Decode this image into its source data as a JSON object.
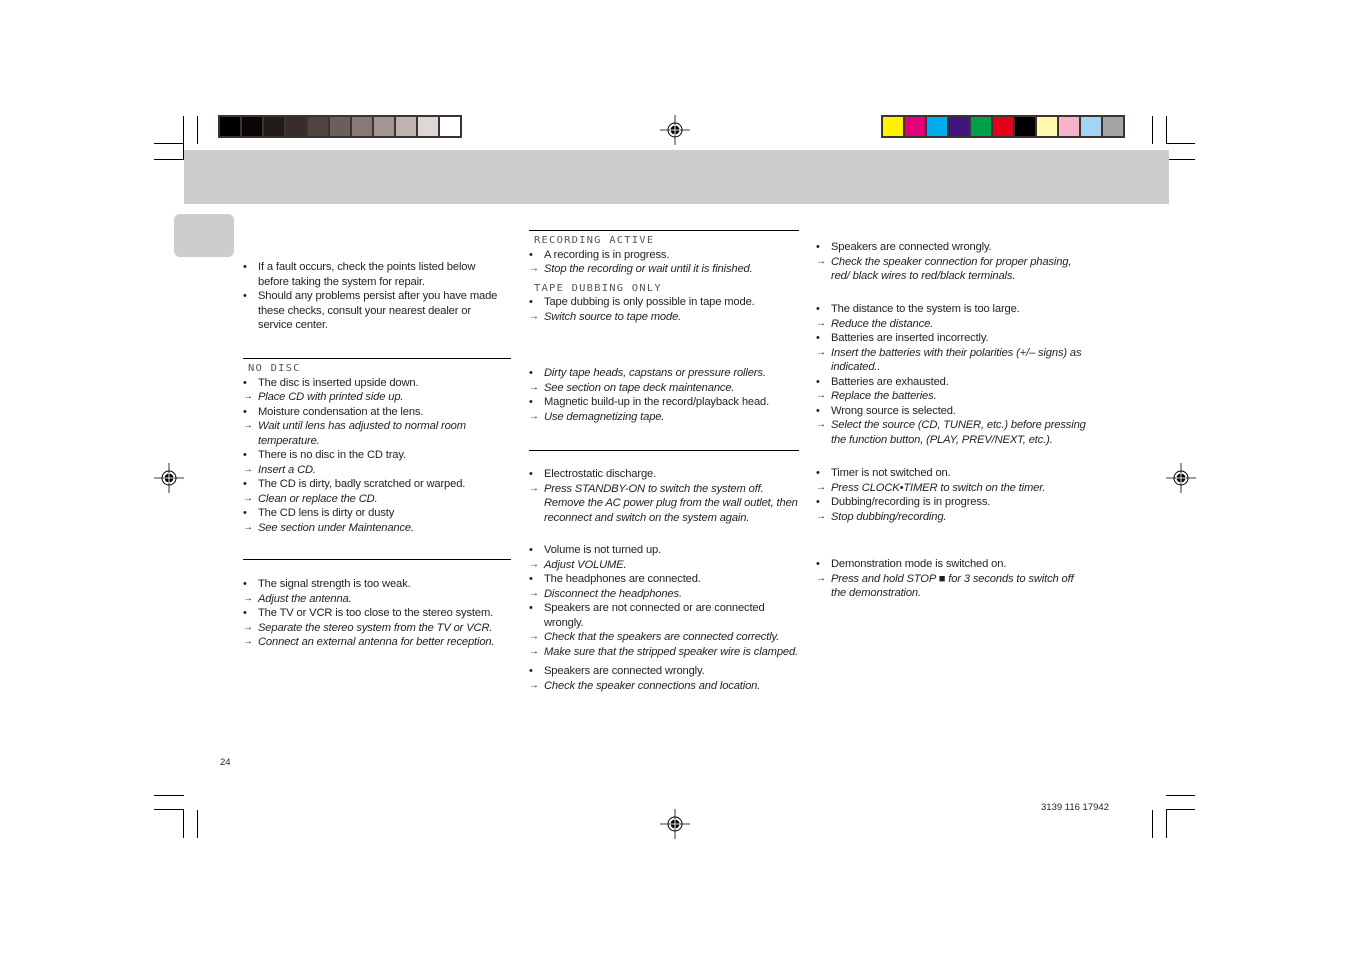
{
  "print_marks": {
    "grayscale_swatches": [
      "#000000",
      "#080606",
      "#221c19",
      "#362c2a",
      "#4e4541",
      "#6a605b",
      "#857a75",
      "#a19692",
      "#bdb4b0",
      "#ddd8d5",
      "#ffffff"
    ],
    "color_swatches": [
      "#fff200",
      "#e4007c",
      "#00aeef",
      "#3f1680",
      "#00a04a",
      "#e2001a",
      "#000000",
      "#fff9b0",
      "#f7b3cc",
      "#a3d4f3",
      "#a3a3a3"
    ]
  },
  "header": {
    "band_color": "#cdcdcd"
  },
  "intro": {
    "items": [
      {
        "type": "cause",
        "text": "If a fault occurs, check the points listed below before taking the system for repair."
      },
      {
        "type": "cause",
        "text": "Should any problems persist after you have made these checks, consult your nearest dealer or service center."
      }
    ]
  },
  "sections": {
    "cd": {
      "display": "NO DISC",
      "items": [
        {
          "type": "cause",
          "text": "The disc is inserted upside down."
        },
        {
          "type": "fix",
          "text": "Place CD with printed side up."
        },
        {
          "type": "cause",
          "text": "Moisture condensation at the lens."
        },
        {
          "type": "fix",
          "text": "Wait until lens has adjusted to normal room temperature."
        },
        {
          "type": "cause",
          "text": "There is no disc in the CD tray."
        },
        {
          "type": "fix",
          "text": "Insert a CD."
        },
        {
          "type": "cause",
          "text": "The CD is dirty, badly scratched or warped."
        },
        {
          "type": "fix",
          "text": "Clean or replace the CD."
        },
        {
          "type": "cause",
          "text": "The CD lens is dirty or dusty"
        },
        {
          "type": "fix",
          "text": "See section under Maintenance."
        }
      ]
    },
    "radio": {
      "items": [
        {
          "type": "cause",
          "text": "The signal strength is too weak."
        },
        {
          "type": "fix",
          "text": "Adjust the antenna."
        },
        {
          "type": "cause",
          "text": "The TV or VCR is too close to the stereo system."
        },
        {
          "type": "fix",
          "text": "Separate the stereo system from the TV or VCR."
        },
        {
          "type": "fix",
          "text": "Connect an external antenna for better reception."
        }
      ]
    },
    "recording": {
      "display": "RECORDING ACTIVE",
      "items": [
        {
          "type": "cause",
          "text": "A recording is in progress."
        },
        {
          "type": "fix",
          "text": "Stop the recording or wait until it is finished."
        }
      ]
    },
    "dubbing": {
      "display": "TAPE DUBBING ONLY",
      "items": [
        {
          "type": "cause",
          "text": "Tape dubbing is only possible in tape mode."
        },
        {
          "type": "fix",
          "text": "Switch source to tape mode."
        }
      ]
    },
    "tape": {
      "items": [
        {
          "type": "cause-italic",
          "text": "Dirty tape heads, capstans or pressure rollers."
        },
        {
          "type": "fix",
          "text": "See section on tape deck maintenance."
        },
        {
          "type": "cause",
          "text": "Magnetic build-up in the record/playback head."
        },
        {
          "type": "fix",
          "text": "Use demagnetizing tape."
        }
      ]
    },
    "no_reaction": {
      "items": [
        {
          "type": "cause",
          "text": "Electrostatic discharge."
        },
        {
          "type": "fix",
          "text": "Press STANDBY-ON to switch the system off. Remove the AC power plug from the wall outlet, then reconnect and switch on the system again."
        }
      ]
    },
    "no_sound": {
      "items": [
        {
          "type": "cause",
          "text": "Volume is not turned up."
        },
        {
          "type": "fix",
          "text": "Adjust VOLUME."
        },
        {
          "type": "cause",
          "text": "The headphones are connected."
        },
        {
          "type": "fix",
          "text": "Disconnect the headphones."
        },
        {
          "type": "cause",
          "text": "Speakers are not connected or are connected wrongly."
        },
        {
          "type": "fix",
          "text": "Check that the speakers are connected correctly."
        },
        {
          "type": "fix",
          "text": "Make sure that the stripped speaker wire is clamped."
        }
      ]
    },
    "sound_bad": {
      "items": [
        {
          "type": "cause",
          "text": "Speakers are connected wrongly."
        },
        {
          "type": "fix",
          "text": "Check the speaker connections and location."
        }
      ]
    },
    "bass": {
      "items": [
        {
          "type": "cause",
          "text": "Speakers are connected wrongly."
        },
        {
          "type": "fix",
          "text": "Check the speaker connection for proper phasing, red/ black wires to red/black terminals."
        }
      ]
    },
    "remote": {
      "items": [
        {
          "type": "cause",
          "text": "The distance to the system is too large."
        },
        {
          "type": "fix",
          "text": "Reduce the distance."
        },
        {
          "type": "cause",
          "text": "Batteries are inserted incorrectly."
        },
        {
          "type": "fix",
          "text": "Insert the batteries with their polarities (+/– signs) as indicated.."
        },
        {
          "type": "cause",
          "text": "Batteries are exhausted."
        },
        {
          "type": "fix",
          "text": "Replace the batteries."
        },
        {
          "type": "cause",
          "text": "Wrong source is selected."
        },
        {
          "type": "fix",
          "text": "Select the source (CD, TUNER, etc.) before pressing the function button, (PLAY, PREV/NEXT, etc.)."
        }
      ]
    },
    "timer": {
      "items": [
        {
          "type": "cause",
          "text": "Timer is not switched on."
        },
        {
          "type": "fix",
          "text": "Press CLOCK•TIMER to switch on the timer."
        },
        {
          "type": "cause",
          "text": "Dubbing/recording is in progress."
        },
        {
          "type": "fix",
          "text": "Stop dubbing/recording."
        }
      ]
    },
    "demo": {
      "items": [
        {
          "type": "cause",
          "text": "Demonstration mode is switched on."
        },
        {
          "type": "fix",
          "text": "Press and hold STOP  ■  for 3 seconds to switch off the demonstration."
        }
      ]
    }
  },
  "footer": {
    "page_number": "24",
    "doc_code": "3139 116 17942"
  },
  "glyphs": {
    "bullet": "•",
    "arrow": "→"
  }
}
